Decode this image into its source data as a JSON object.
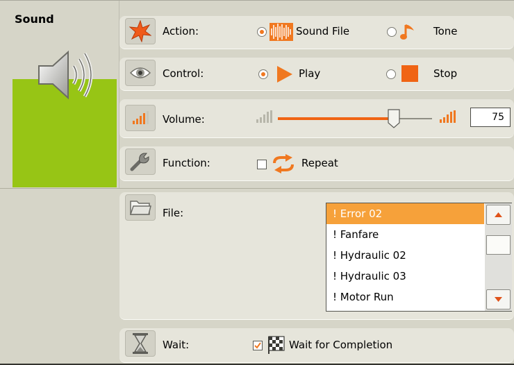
{
  "block": {
    "title": "Sound",
    "icon": "speaker-icon",
    "accent_color": "#97c515"
  },
  "action": {
    "label": "Action:",
    "icon": "action-star-icon",
    "options": [
      {
        "label": "Sound File",
        "icon": "sound-wave-icon",
        "selected": true
      },
      {
        "label": "Tone",
        "icon": "music-note-icon",
        "selected": false
      }
    ]
  },
  "control": {
    "label": "Control:",
    "icon": "eye-icon",
    "options": [
      {
        "label": "Play",
        "icon": "play-icon",
        "selected": true
      },
      {
        "label": "Stop",
        "icon": "stop-icon",
        "selected": false
      }
    ]
  },
  "volume": {
    "label": "Volume:",
    "icon": "volume-bars-icon",
    "value": "75",
    "slider_percent": 75
  },
  "function": {
    "label": "Function:",
    "icon": "wrench-icon",
    "repeat": {
      "label": "Repeat",
      "icon": "repeat-arrows-icon",
      "checked": false
    }
  },
  "file": {
    "label": "File:",
    "icon": "folder-icon",
    "items": [
      "! Error 02",
      "! Fanfare",
      "! Hydraulic 02",
      "! Hydraulic 03",
      "! Motor Run"
    ],
    "selected_index": 0
  },
  "wait": {
    "label": "Wait:",
    "icon": "hourglass-icon",
    "completion": {
      "label": "Wait for Completion",
      "icon": "checkered-flag-icon",
      "checked": true
    }
  },
  "colors": {
    "accent_orange": "#f07820",
    "selection": "#f6a13a"
  }
}
